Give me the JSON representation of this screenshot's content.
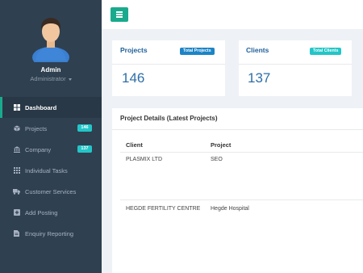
{
  "profile": {
    "name": "Admin",
    "role": "Administrator"
  },
  "sidebar": {
    "items": [
      {
        "label": "Dashboard",
        "icon": "dashboard-icon"
      },
      {
        "label": "Projects",
        "icon": "cube-icon",
        "badge": "146",
        "badge_color": "#23c6c8"
      },
      {
        "label": "Company",
        "icon": "bank-icon",
        "badge": "137",
        "badge_color": "#23c6c8"
      },
      {
        "label": "Individual Tasks",
        "icon": "grid-icon"
      },
      {
        "label": "Customer Services",
        "icon": "truck-icon"
      },
      {
        "label": "Add Posting",
        "icon": "plus-square-icon"
      },
      {
        "label": "Enquiry Reporting",
        "icon": "file-icon"
      }
    ]
  },
  "stats": {
    "projects": {
      "title": "Projects",
      "label": "Total Projects",
      "label_color": "#1c84c6",
      "value": "146"
    },
    "clients": {
      "title": "Clients",
      "label": "Total Clients",
      "label_color": "#23c6c8",
      "value": "137"
    }
  },
  "details": {
    "title": "Project Details (Latest Projects)",
    "columns": [
      "Client",
      "Project"
    ],
    "rows": [
      [
        "PLASMIX LTD",
        "SEO"
      ],
      [
        "HEGDE FERTILITY CENTRE",
        "Hegde Hospital"
      ]
    ]
  },
  "colors": {
    "accent": "#19aa8d",
    "sidebar": "#2f4050"
  }
}
